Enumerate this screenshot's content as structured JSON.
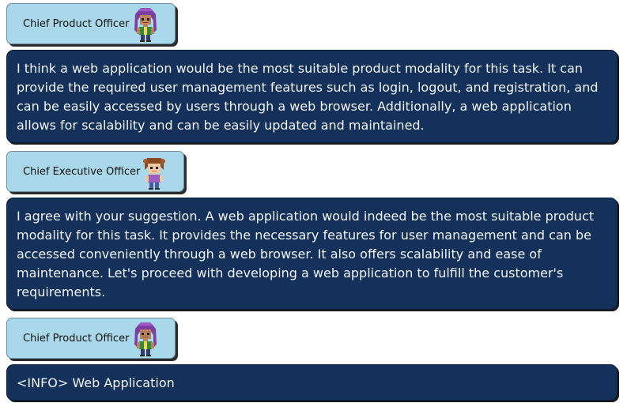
{
  "messages": [
    {
      "role": "Chief Product Officer",
      "text": "I think a web application would be the most suitable product modality for this task. It can provide the required user management features such as login, logout, and registration, and can be easily accessed by users through a web browser. Additionally, a web application allows for scalability and can be easily updated and maintained."
    },
    {
      "role": "Chief Executive Officer",
      "text": "I agree with your suggestion. A web application would indeed be the most suitable product modality for this task. It provides the necessary features for user management and can be accessed conveniently through a web browser. It also offers scalability and ease of maintenance. Let's proceed with developing a web application to fulfill the customer's requirements."
    },
    {
      "role": "Chief Product Officer",
      "text": "<INFO> Web Application"
    }
  ],
  "icons": {
    "cpo_avatar": "purple-haired-pixel-character-icon",
    "ceo_avatar": "brown-haired-pixel-character-icon"
  },
  "colors": {
    "role_tag_bg": "#a9d8ea",
    "bubble_bg": "#13315a",
    "bubble_text": "#f2f4f8"
  }
}
